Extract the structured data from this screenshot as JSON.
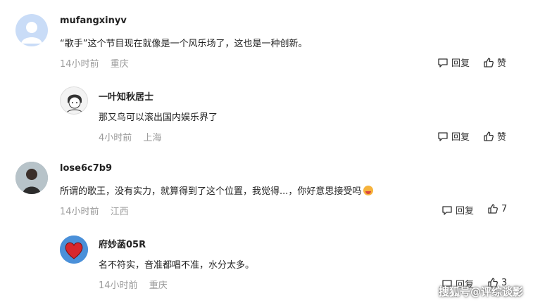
{
  "comments": [
    {
      "username": "mufangxinyv",
      "text": "“歌手”这个节目现在就像是一个风乐场了，这也是一种创新。",
      "time": "14小时前",
      "location": "重庆",
      "reply_label": "回复",
      "like_label": "赞"
    },
    {
      "username": "一叶知秋居士",
      "text": "那又鸟可以滚出国内娱乐界了",
      "time": "4小时前",
      "location": "上海",
      "reply_label": "回复",
      "like_label": "赞"
    },
    {
      "username": "lose6c7b9",
      "text": "所谓的歌王，没有实力，就算得到了这个位置，我觉得...，你好意思接受吗",
      "time": "14小时前",
      "location": "江西",
      "reply_label": "回复",
      "like_label": "7"
    },
    {
      "username": "府妙菡05R",
      "text": "名不符实，音准都唱不准，水分太多。",
      "time": "14小时前",
      "location": "重庆",
      "reply_label": "回复",
      "like_label": "3"
    }
  ],
  "watermark": "搜狐号@评综谈影",
  "colors": {
    "meta": "#9a9a9a",
    "text": "#222222",
    "heart": "#d7262c"
  }
}
